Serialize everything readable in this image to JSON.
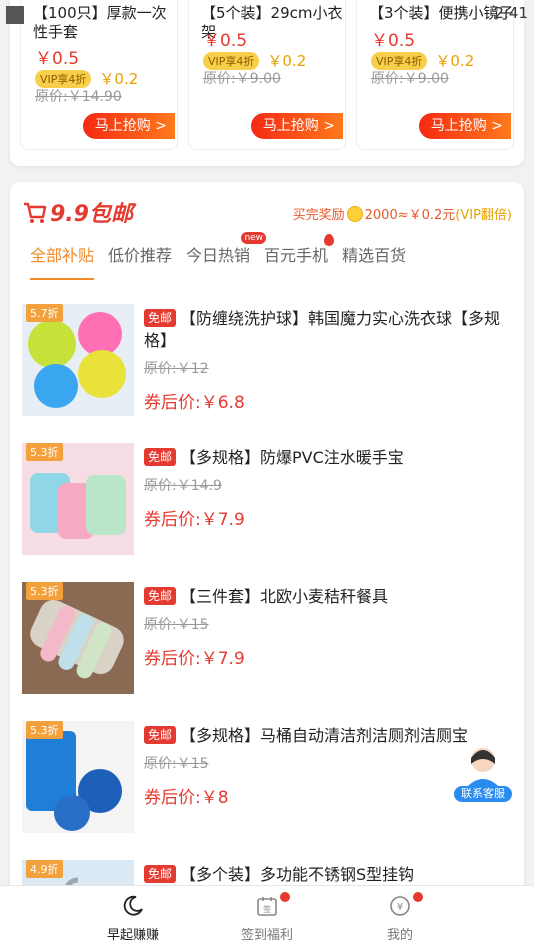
{
  "status_bar": {
    "time": "2:41"
  },
  "top_products": [
    {
      "title": "【100只】厚款一次性手套",
      "price": "￥0.5",
      "vip_label": "VIP享4折",
      "vip_price": "￥0.2",
      "original": "原价:￥14.90",
      "button": "马上抢购 >"
    },
    {
      "title": "【5个装】29cm小衣架",
      "price": "￥0.5",
      "vip_label": "VIP享4折",
      "vip_price": "￥0.2",
      "original": "原价:￥9.00",
      "button": "马上抢购 >"
    },
    {
      "title": "【3个装】便携小镜子",
      "price": "￥0.5",
      "vip_label": "VIP享4折",
      "vip_price": "￥0.2",
      "original": "原价:￥9.00",
      "button": "马上抢购 >"
    }
  ],
  "section": {
    "logo_text": "9.9包邮",
    "reward_prefix": "买完奖励",
    "reward_value": "2000≈￥0.2元",
    "reward_vip": "(VIP翻倍)"
  },
  "tabs": [
    {
      "label": "全部补贴"
    },
    {
      "label": "低价推荐"
    },
    {
      "label": "今日热销",
      "badge": "new"
    },
    {
      "label": "百元手机"
    },
    {
      "label": "精选百货"
    }
  ],
  "items": [
    {
      "discount": "5.7折",
      "tag": "免邮",
      "title": "【防缠绕洗护球】韩国魔力实心洗衣球【多规格】",
      "original": "原价:￥12",
      "coupon": "券后价:￥6.8"
    },
    {
      "discount": "5.3折",
      "tag": "免邮",
      "title": "【多规格】防爆PVC注水暖手宝",
      "original": "原价:￥14.9",
      "coupon": "券后价:￥7.9"
    },
    {
      "discount": "5.3折",
      "tag": "免邮",
      "title": "【三件套】北欧小麦秸秆餐具",
      "original": "原价:￥15",
      "coupon": "券后价:￥7.9"
    },
    {
      "discount": "5.3折",
      "tag": "免邮",
      "title": "【多规格】马桶自动清洁剂洁厕剂洁厕宝",
      "original": "原价:￥15",
      "coupon": "券后价:￥8"
    },
    {
      "discount": "4.9折",
      "tag": "免邮",
      "title": "【多个装】多功能不锈钢S型挂钩",
      "original": "",
      "coupon": ""
    }
  ],
  "service": {
    "label": "联系客服"
  },
  "bottom_nav": [
    {
      "label": "早起赚赚"
    },
    {
      "label": "签到福利",
      "icon_text": "签"
    },
    {
      "label": "我的",
      "icon_text": "¥"
    }
  ],
  "colors": {
    "accent": "#e53a30",
    "orange": "#f08a24",
    "vip": "#f7cf4a"
  }
}
